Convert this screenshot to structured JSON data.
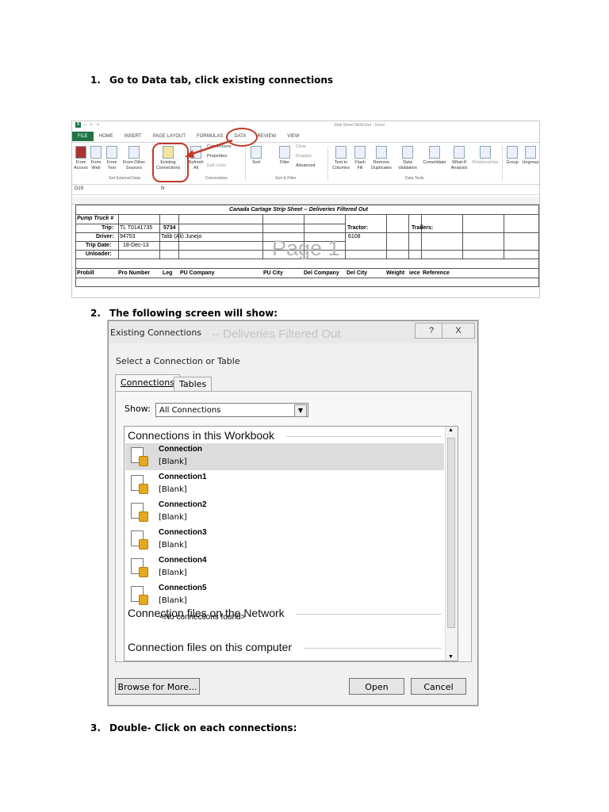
{
  "steps": [
    {
      "num": "1.",
      "text": "Go to Data tab, click existing connections"
    },
    {
      "num": "2.",
      "text": "The following screen will show:"
    },
    {
      "num": "3.",
      "text": "Double- Click on each connections:"
    }
  ],
  "excel": {
    "window_title": "Strip Sheet NEW.xlsx - Excel",
    "tabs": [
      "FILE",
      "HOME",
      "INSERT",
      "PAGE LAYOUT",
      "FORMULAS",
      "DATA",
      "REVIEW",
      "VIEW"
    ],
    "ribbon": {
      "from_access": "From Access",
      "from_web": "From Web",
      "from_text": "From Text",
      "from_other": "From Other Sources",
      "existing": "Existing Connections",
      "refresh": "Refresh All",
      "connections": "Connections",
      "properties": "Properties",
      "edit_links": "Edit Links",
      "sort": "Sort",
      "filter": "Filter",
      "clear": "Clear",
      "reapply": "Reapply",
      "advanced": "Advanced",
      "text_to_columns": "Text to Columns",
      "flash_fill": "Flash Fill",
      "remove_duplicates": "Remove Duplicates",
      "data_validation": "Data Validation",
      "consolidate": "Consolidate",
      "what_if": "What-If Analysis",
      "relationships": "Relationships",
      "group": "Group",
      "ungroup": "Ungroup"
    },
    "groups": [
      "Get External Data",
      "Connections",
      "Sort & Filter",
      "Data Tools"
    ],
    "name_box": "D19",
    "fx": "fx",
    "sheet": {
      "title": "Canada Cartage Strip Sheet -- Deliveries Filtered Out",
      "pump_truck": "Pump Truck #",
      "trip_label": "Trip:",
      "trip_id": "TL T0141735",
      "trip_num": "5734",
      "tractor_label": "Tractor:",
      "tractor_val": "6108",
      "trailers_label": "Trailers:",
      "driver_label": "Driver:",
      "driver_id": "94753",
      "driver_name": "Talib (Ali) Junejo",
      "trip_date_label": "Trip Date:",
      "trip_date": "18-Dec-13",
      "unloader_label": "Unloader:",
      "watermark": "Page 1",
      "columns": [
        "Probill",
        "Pro Number",
        "Leg",
        "PU Company",
        "PU City",
        "Del Company",
        "Del City",
        "Weight",
        "iece",
        "Reference"
      ]
    }
  },
  "dialog": {
    "title": "Existing Connections",
    "ghost_text": "-- Deliveries Filtered Out",
    "help": "?",
    "close": "X",
    "prompt": "Select a Connection or Table",
    "tab_connections": "Connections",
    "tab_tables": "Tables",
    "show_label": "Show:",
    "show_value": "All Connections",
    "section_workbook": "Connections in this Workbook",
    "connections": [
      {
        "name": "Connection",
        "desc": "[Blank]"
      },
      {
        "name": "Connection1",
        "desc": "[Blank]"
      },
      {
        "name": "Connection2",
        "desc": "[Blank]"
      },
      {
        "name": "Connection3",
        "desc": "[Blank]"
      },
      {
        "name": "Connection4",
        "desc": "[Blank]"
      },
      {
        "name": "Connection5",
        "desc": "[Blank]"
      }
    ],
    "section_network": "Connection files on the Network",
    "no_connections": "<No connections found>",
    "section_computer": "Connection files on this computer",
    "browse": "Browse for More...",
    "open": "Open",
    "cancel": "Cancel"
  }
}
